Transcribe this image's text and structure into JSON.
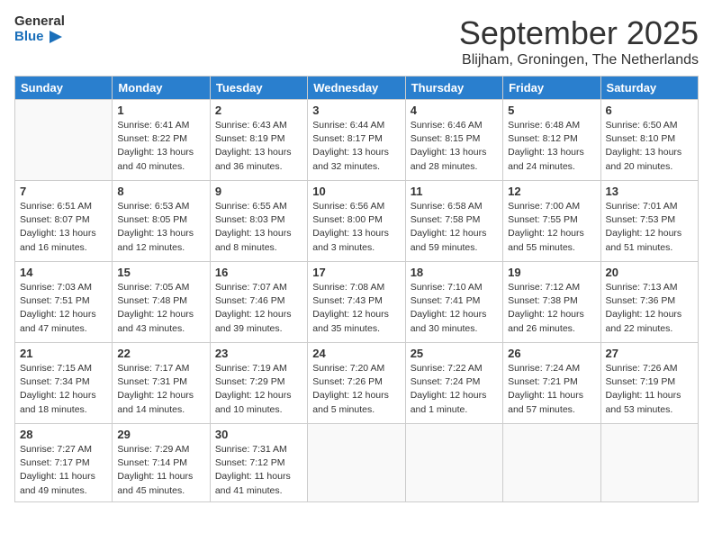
{
  "header": {
    "logo_general": "General",
    "logo_blue": "Blue",
    "month": "September 2025",
    "location": "Blijham, Groningen, The Netherlands"
  },
  "days_of_week": [
    "Sunday",
    "Monday",
    "Tuesday",
    "Wednesday",
    "Thursday",
    "Friday",
    "Saturday"
  ],
  "weeks": [
    [
      {
        "day": "",
        "info": ""
      },
      {
        "day": "1",
        "info": "Sunrise: 6:41 AM\nSunset: 8:22 PM\nDaylight: 13 hours\nand 40 minutes."
      },
      {
        "day": "2",
        "info": "Sunrise: 6:43 AM\nSunset: 8:19 PM\nDaylight: 13 hours\nand 36 minutes."
      },
      {
        "day": "3",
        "info": "Sunrise: 6:44 AM\nSunset: 8:17 PM\nDaylight: 13 hours\nand 32 minutes."
      },
      {
        "day": "4",
        "info": "Sunrise: 6:46 AM\nSunset: 8:15 PM\nDaylight: 13 hours\nand 28 minutes."
      },
      {
        "day": "5",
        "info": "Sunrise: 6:48 AM\nSunset: 8:12 PM\nDaylight: 13 hours\nand 24 minutes."
      },
      {
        "day": "6",
        "info": "Sunrise: 6:50 AM\nSunset: 8:10 PM\nDaylight: 13 hours\nand 20 minutes."
      }
    ],
    [
      {
        "day": "7",
        "info": "Sunrise: 6:51 AM\nSunset: 8:07 PM\nDaylight: 13 hours\nand 16 minutes."
      },
      {
        "day": "8",
        "info": "Sunrise: 6:53 AM\nSunset: 8:05 PM\nDaylight: 13 hours\nand 12 minutes."
      },
      {
        "day": "9",
        "info": "Sunrise: 6:55 AM\nSunset: 8:03 PM\nDaylight: 13 hours\nand 8 minutes."
      },
      {
        "day": "10",
        "info": "Sunrise: 6:56 AM\nSunset: 8:00 PM\nDaylight: 13 hours\nand 3 minutes."
      },
      {
        "day": "11",
        "info": "Sunrise: 6:58 AM\nSunset: 7:58 PM\nDaylight: 12 hours\nand 59 minutes."
      },
      {
        "day": "12",
        "info": "Sunrise: 7:00 AM\nSunset: 7:55 PM\nDaylight: 12 hours\nand 55 minutes."
      },
      {
        "day": "13",
        "info": "Sunrise: 7:01 AM\nSunset: 7:53 PM\nDaylight: 12 hours\nand 51 minutes."
      }
    ],
    [
      {
        "day": "14",
        "info": "Sunrise: 7:03 AM\nSunset: 7:51 PM\nDaylight: 12 hours\nand 47 minutes."
      },
      {
        "day": "15",
        "info": "Sunrise: 7:05 AM\nSunset: 7:48 PM\nDaylight: 12 hours\nand 43 minutes."
      },
      {
        "day": "16",
        "info": "Sunrise: 7:07 AM\nSunset: 7:46 PM\nDaylight: 12 hours\nand 39 minutes."
      },
      {
        "day": "17",
        "info": "Sunrise: 7:08 AM\nSunset: 7:43 PM\nDaylight: 12 hours\nand 35 minutes."
      },
      {
        "day": "18",
        "info": "Sunrise: 7:10 AM\nSunset: 7:41 PM\nDaylight: 12 hours\nand 30 minutes."
      },
      {
        "day": "19",
        "info": "Sunrise: 7:12 AM\nSunset: 7:38 PM\nDaylight: 12 hours\nand 26 minutes."
      },
      {
        "day": "20",
        "info": "Sunrise: 7:13 AM\nSunset: 7:36 PM\nDaylight: 12 hours\nand 22 minutes."
      }
    ],
    [
      {
        "day": "21",
        "info": "Sunrise: 7:15 AM\nSunset: 7:34 PM\nDaylight: 12 hours\nand 18 minutes."
      },
      {
        "day": "22",
        "info": "Sunrise: 7:17 AM\nSunset: 7:31 PM\nDaylight: 12 hours\nand 14 minutes."
      },
      {
        "day": "23",
        "info": "Sunrise: 7:19 AM\nSunset: 7:29 PM\nDaylight: 12 hours\nand 10 minutes."
      },
      {
        "day": "24",
        "info": "Sunrise: 7:20 AM\nSunset: 7:26 PM\nDaylight: 12 hours\nand 5 minutes."
      },
      {
        "day": "25",
        "info": "Sunrise: 7:22 AM\nSunset: 7:24 PM\nDaylight: 12 hours\nand 1 minute."
      },
      {
        "day": "26",
        "info": "Sunrise: 7:24 AM\nSunset: 7:21 PM\nDaylight: 11 hours\nand 57 minutes."
      },
      {
        "day": "27",
        "info": "Sunrise: 7:26 AM\nSunset: 7:19 PM\nDaylight: 11 hours\nand 53 minutes."
      }
    ],
    [
      {
        "day": "28",
        "info": "Sunrise: 7:27 AM\nSunset: 7:17 PM\nDaylight: 11 hours\nand 49 minutes."
      },
      {
        "day": "29",
        "info": "Sunrise: 7:29 AM\nSunset: 7:14 PM\nDaylight: 11 hours\nand 45 minutes."
      },
      {
        "day": "30",
        "info": "Sunrise: 7:31 AM\nSunset: 7:12 PM\nDaylight: 11 hours\nand 41 minutes."
      },
      {
        "day": "",
        "info": ""
      },
      {
        "day": "",
        "info": ""
      },
      {
        "day": "",
        "info": ""
      },
      {
        "day": "",
        "info": ""
      }
    ]
  ]
}
